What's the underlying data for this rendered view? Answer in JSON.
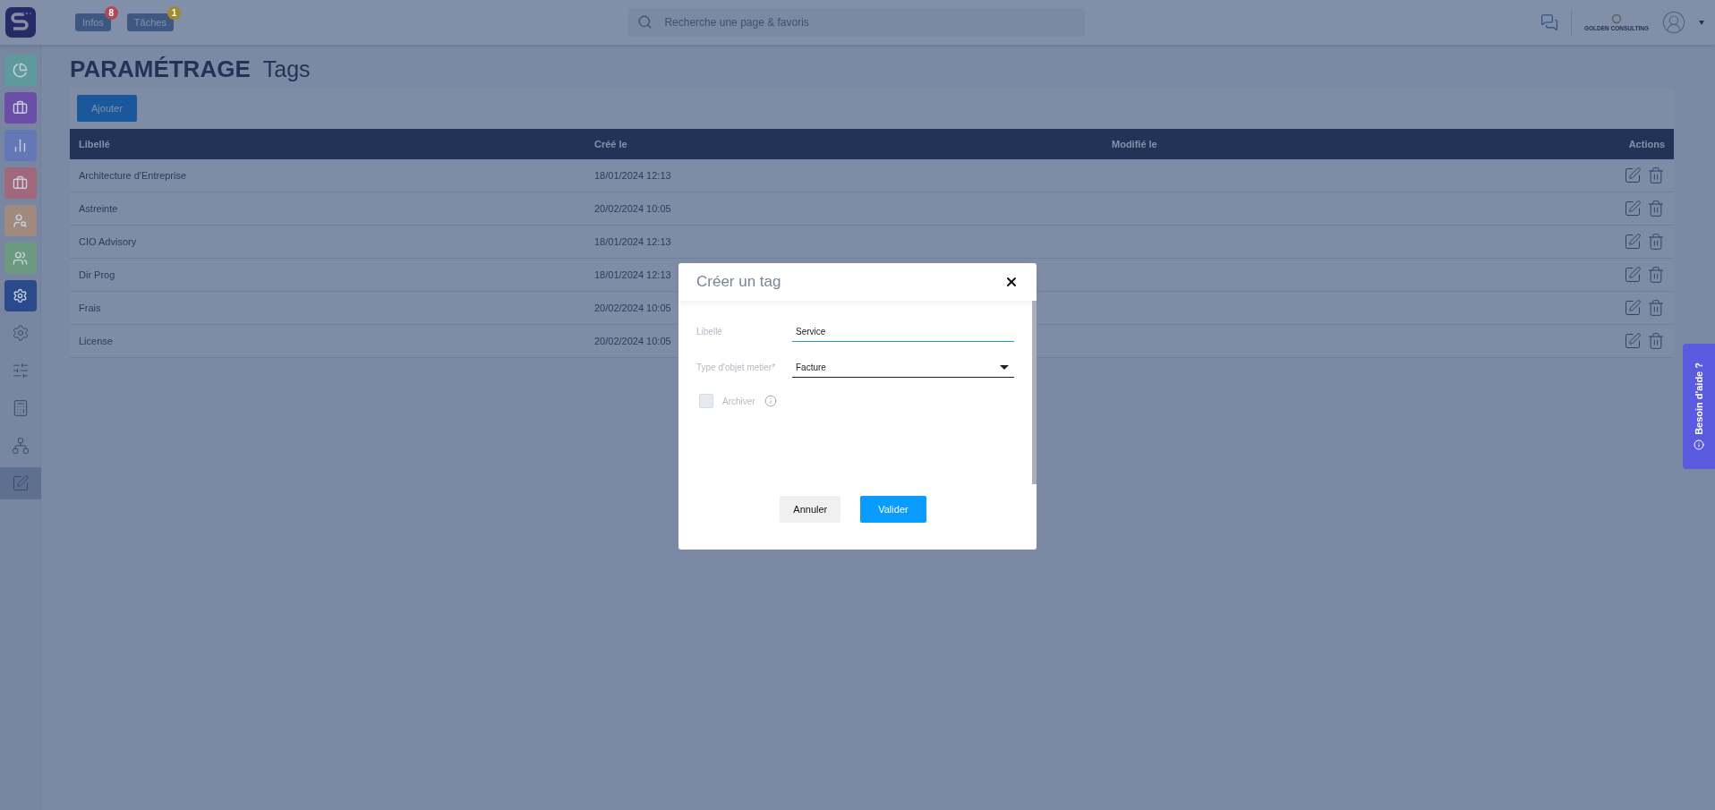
{
  "topbar": {
    "badges": [
      {
        "label": "Infos",
        "count": "8",
        "color": "#b04a5a"
      },
      {
        "label": "Tâches",
        "count": "1",
        "color": "#a08a30"
      }
    ],
    "search": {
      "placeholder": "Recherche une page & favoris"
    },
    "company": "GOLDEN CONSULTING"
  },
  "sidebar": {
    "items": [
      {
        "kind": "tile",
        "color": "#5e9a9c",
        "selected": false
      },
      {
        "kind": "tile",
        "color": "#6a4ea8",
        "selected": false
      },
      {
        "kind": "tile",
        "color": "#6478b8",
        "selected": false
      },
      {
        "kind": "tile",
        "color": "#a0687a",
        "selected": false
      },
      {
        "kind": "tile",
        "color": "#a08a80",
        "selected": false
      },
      {
        "kind": "tile",
        "color": "#6c9a80",
        "selected": false
      },
      {
        "kind": "tile",
        "color": "#2a4a8c",
        "selected": false
      },
      {
        "kind": "plain",
        "selected": false
      },
      {
        "kind": "plain",
        "selected": false
      },
      {
        "kind": "plain",
        "selected": false
      },
      {
        "kind": "plain",
        "selected": false
      },
      {
        "kind": "plain",
        "selected": true
      }
    ]
  },
  "page": {
    "title": "PARAMÉTRAGE",
    "subtitle": "Tags",
    "add_button": "Ajouter"
  },
  "table": {
    "columns": [
      "Libellé",
      "Créé le",
      "Modifié le",
      "Actions"
    ],
    "rows": [
      {
        "label": "Architecture d'Entreprise",
        "created": "18/01/2024 12:13"
      },
      {
        "label": "Astreinte",
        "created": "20/02/2024 10:05"
      },
      {
        "label": "CIO Advisory",
        "created": "18/01/2024 12:13"
      },
      {
        "label": "Dir Prog",
        "created": "18/01/2024 12:13"
      },
      {
        "label": "Frais",
        "created": "20/02/2024 10:05"
      },
      {
        "label": "License",
        "created": "20/02/2024 10:05"
      }
    ]
  },
  "dialog": {
    "title": "Créer un tag",
    "fields": [
      {
        "kind": "text",
        "label": "Libellé",
        "value": "Service",
        "focused": true
      },
      {
        "kind": "select",
        "label": "Type d'objet metier*",
        "value": "Facture",
        "focused": false
      }
    ],
    "archive": {
      "label": "Archiver",
      "checked": false,
      "disabled": true
    },
    "buttons": [
      {
        "label": "Annuler",
        "kind": "secondary"
      },
      {
        "label": "Valider",
        "kind": "primary"
      }
    ]
  },
  "help_tab": {
    "label": "Besoin d'aide ?"
  }
}
